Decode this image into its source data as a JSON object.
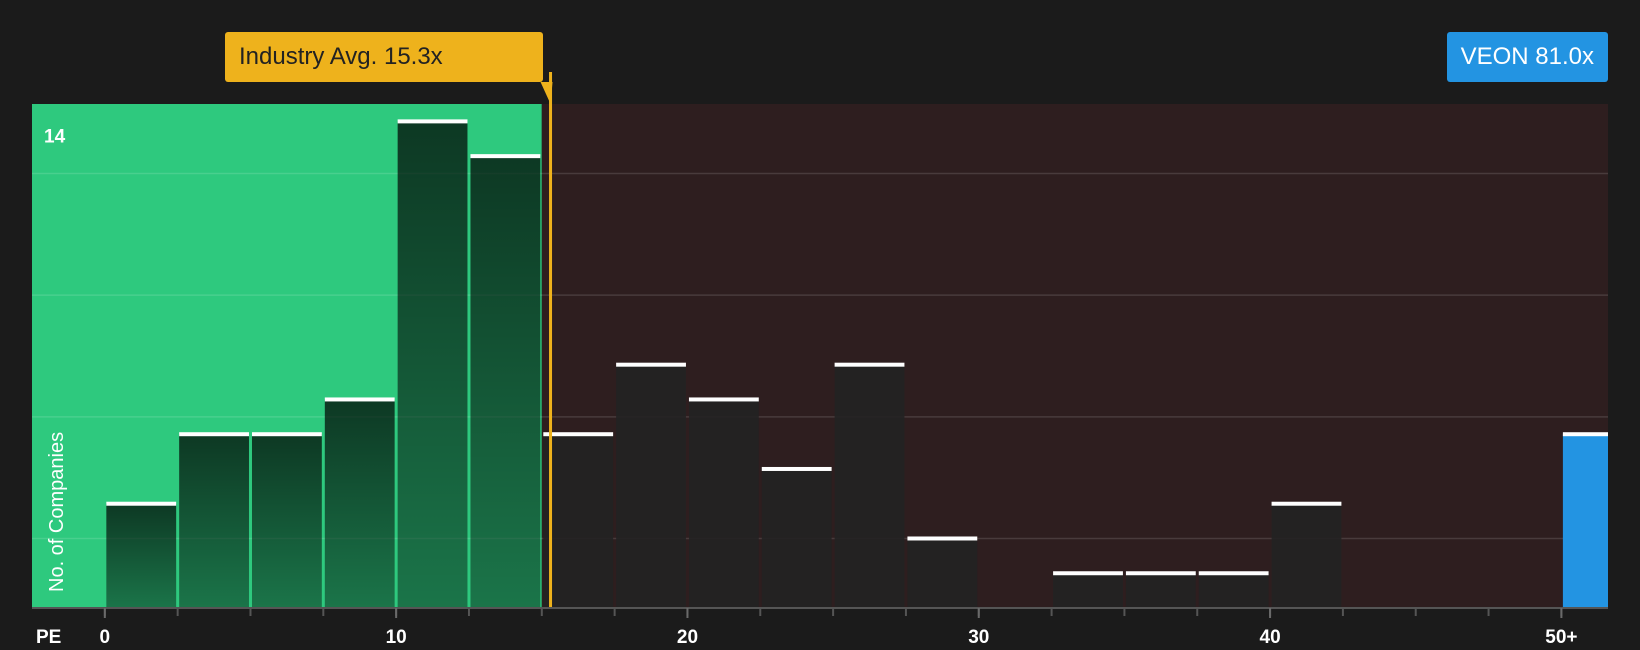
{
  "chart_data": {
    "type": "bar",
    "xlabel": "PE",
    "ylabel": "No. of Companies",
    "xlim": [
      -2.5,
      51.6
    ],
    "ylim": [
      0,
      14.5
    ],
    "x_ticks": [
      {
        "value": 0,
        "label": "0"
      },
      {
        "value": 10,
        "label": "10"
      },
      {
        "value": 20,
        "label": "20"
      },
      {
        "value": 30,
        "label": "30"
      },
      {
        "value": 40,
        "label": "40"
      },
      {
        "value": 50,
        "label": "50+"
      }
    ],
    "y_ticks": [
      {
        "value": 14,
        "label": "14"
      }
    ],
    "bins": [
      {
        "start": 0,
        "end": 2.5,
        "count": 3
      },
      {
        "start": 2.5,
        "end": 5,
        "count": 5
      },
      {
        "start": 5,
        "end": 7.5,
        "count": 5
      },
      {
        "start": 7.5,
        "end": 10,
        "count": 6
      },
      {
        "start": 10,
        "end": 12.5,
        "count": 14
      },
      {
        "start": 12.5,
        "end": 15,
        "count": 13
      },
      {
        "start": 15,
        "end": 17.5,
        "count": 5
      },
      {
        "start": 17.5,
        "end": 20,
        "count": 7
      },
      {
        "start": 20,
        "end": 22.5,
        "count": 6
      },
      {
        "start": 22.5,
        "end": 25,
        "count": 4
      },
      {
        "start": 25,
        "end": 27.5,
        "count": 7
      },
      {
        "start": 27.5,
        "end": 30,
        "count": 2
      },
      {
        "start": 30,
        "end": 32.5,
        "count": 0
      },
      {
        "start": 32.5,
        "end": 35,
        "count": 1
      },
      {
        "start": 35,
        "end": 37.5,
        "count": 1
      },
      {
        "start": 37.5,
        "end": 40,
        "count": 1
      },
      {
        "start": 40,
        "end": 42.5,
        "count": 3
      },
      {
        "start": 42.5,
        "end": 45,
        "count": 0
      },
      {
        "start": 45,
        "end": 47.5,
        "count": 0
      },
      {
        "start": 47.5,
        "end": 50,
        "count": 0
      }
    ],
    "industry_avg": {
      "value": 15.3,
      "label": "Industry Avg. 15.3x"
    },
    "company": {
      "name": "VEON",
      "value": 81.0,
      "label": "VEON 81.0x",
      "plot_x": 50,
      "count": 5
    },
    "grid": true,
    "colors": {
      "below_avg_region": "#2ec97e",
      "above_avg_region": "#2e1e1f",
      "bar_fill": "#222222",
      "bar_top": "#ffffff",
      "avg_line": "#eeb21c",
      "company_bar": "#2394e2",
      "background": "#1b1b1b"
    }
  }
}
